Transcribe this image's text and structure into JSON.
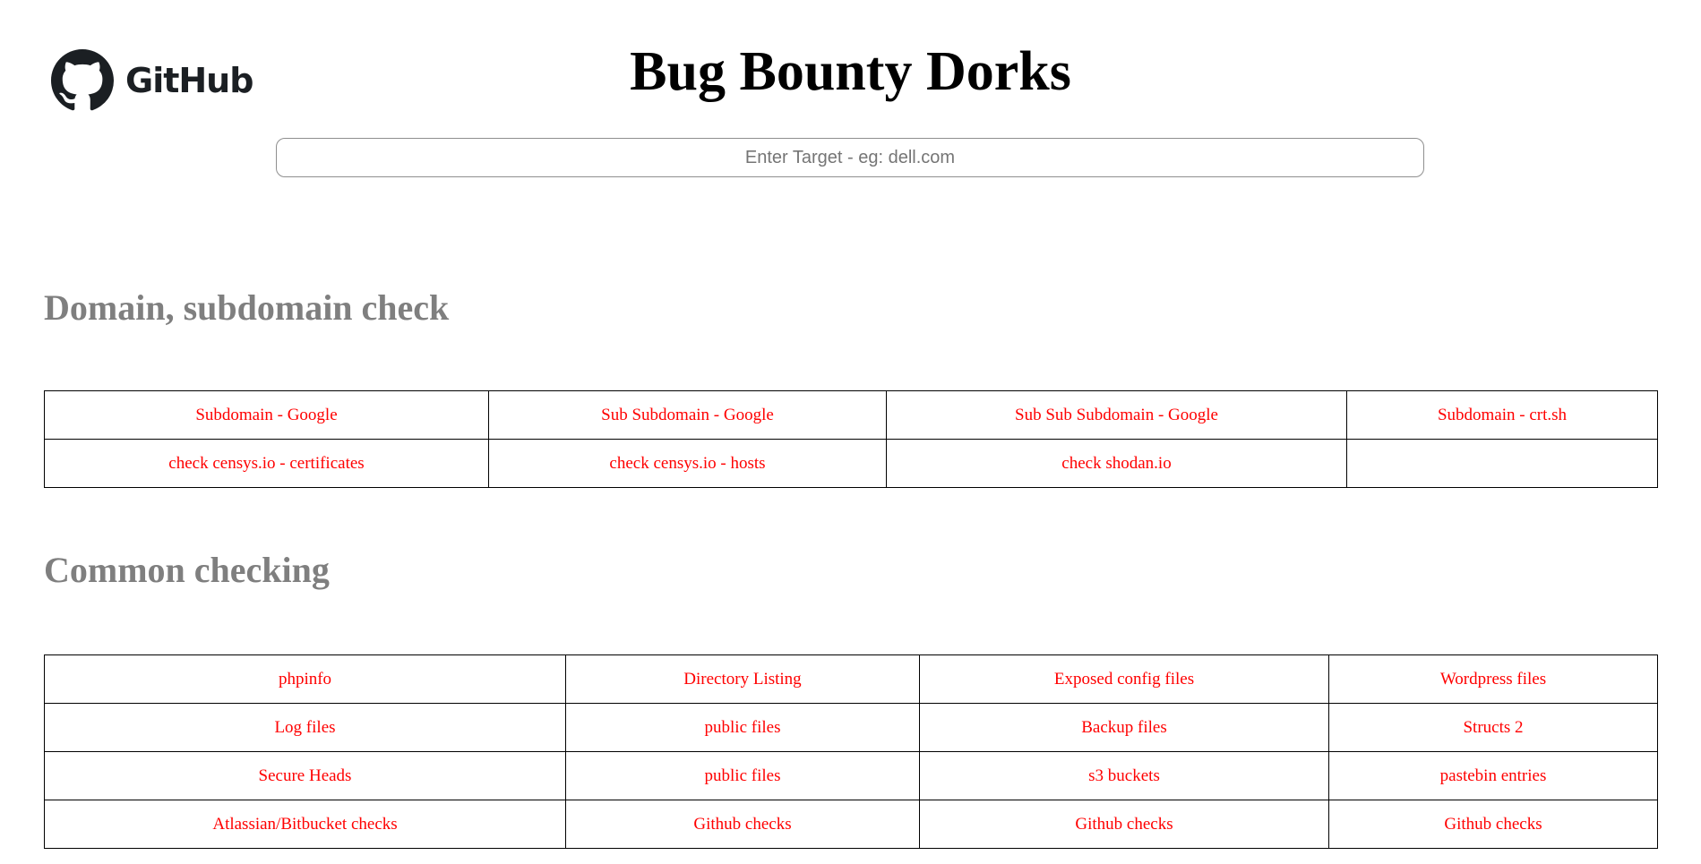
{
  "header": {
    "logo_text": "GitHub",
    "title": "Bug Bounty Dorks"
  },
  "search": {
    "placeholder": "Enter Target - eg: dell.com"
  },
  "sections": [
    {
      "title": "Domain, subdomain check",
      "rows": [
        [
          "Subdomain - Google",
          "Sub Subdomain - Google",
          "Sub Sub Subdomain - Google",
          "Subdomain - crt.sh"
        ],
        [
          "check censys.io - certificates",
          "check censys.io - hosts",
          "check shodan.io",
          ""
        ]
      ]
    },
    {
      "title": "Common checking",
      "rows": [
        [
          "phpinfo",
          "Directory Listing",
          "Exposed config files",
          "Wordpress files"
        ],
        [
          "Log files",
          "public files",
          "Backup files",
          "Structs 2"
        ],
        [
          "Secure Heads",
          "public files",
          "s3 buckets",
          "pastebin entries"
        ],
        [
          "Atlassian/Bitbucket checks",
          "Github checks",
          "Github checks",
          "Github checks"
        ]
      ]
    }
  ],
  "colors": {
    "link": "#ff0000",
    "section_title": "#7f7f7f",
    "title": "#000000"
  },
  "icons": {
    "logo": "github-octocat-icon"
  }
}
